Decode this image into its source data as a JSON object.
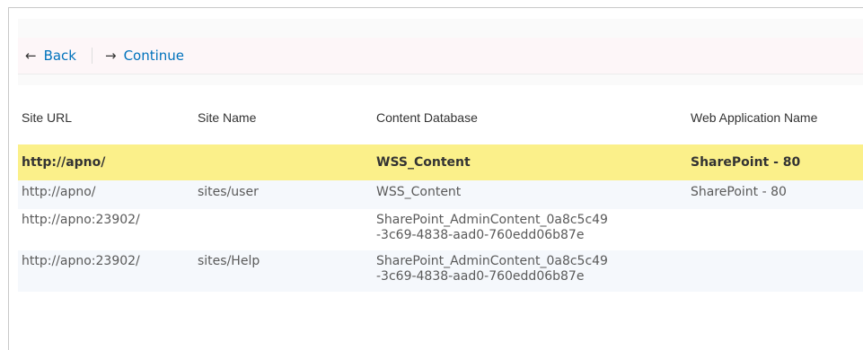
{
  "toolbar": {
    "back_label": "Back",
    "continue_label": "Continue"
  },
  "table": {
    "columns": [
      "Site URL",
      "Site Name",
      "Content Database",
      "Web Application Name"
    ],
    "rows": [
      {
        "url": "http://apno/",
        "name": "",
        "database": [
          "WSS_Content"
        ],
        "webapp": "SharePoint - 80",
        "selected": true
      },
      {
        "url": "http://apno/",
        "name": "sites/user",
        "database": [
          "WSS_Content"
        ],
        "webapp": "SharePoint - 80",
        "selected": false
      },
      {
        "url": "http://apno:23902/",
        "name": "",
        "database": [
          "SharePoint_AdminContent_0a8c5c49",
          "-3c69-4838-aad0-760edd06b87e"
        ],
        "webapp": "",
        "selected": false
      },
      {
        "url": "http://apno:23902/",
        "name": "sites/Help",
        "database": [
          "SharePoint_AdminContent_0a8c5c49",
          "-3c69-4838-aad0-760edd06b87e"
        ],
        "webapp": "",
        "selected": false
      }
    ]
  },
  "colors": {
    "link": "#0072bc",
    "selected_row": "#fbf08a",
    "alt_row": "#f5f8fc"
  }
}
